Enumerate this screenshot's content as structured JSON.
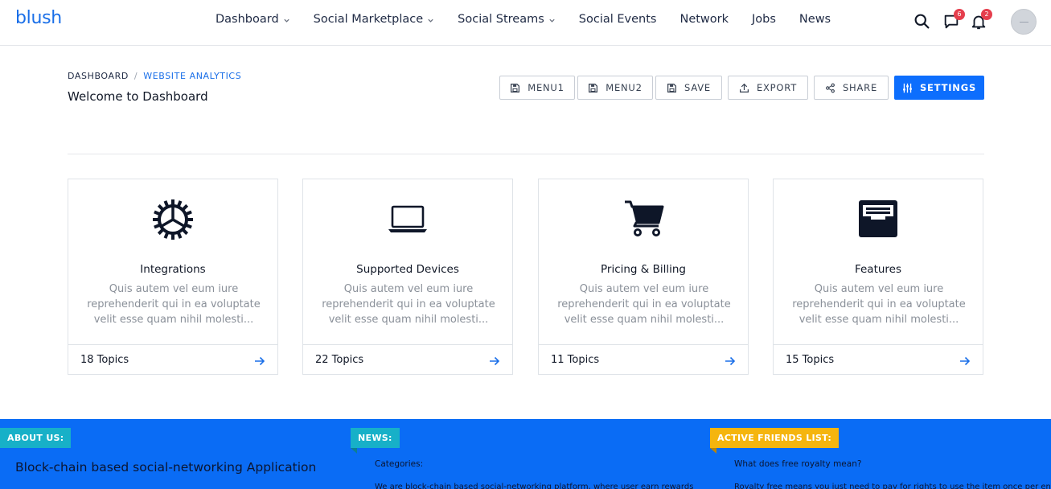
{
  "brand": "blush",
  "nav": [
    {
      "label": "Dashboard",
      "dropdown": true
    },
    {
      "label": "Social Marketplace",
      "dropdown": true
    },
    {
      "label": "Social Streams",
      "dropdown": true
    },
    {
      "label": "Social Events",
      "dropdown": false
    },
    {
      "label": "Network",
      "dropdown": false
    },
    {
      "label": "Jobs",
      "dropdown": false
    },
    {
      "label": "News",
      "dropdown": false
    }
  ],
  "header": {
    "messages_badge": "6",
    "notifications_badge": "2"
  },
  "breadcrumb": {
    "root": "DASHBOARD",
    "separator": "/",
    "current": "WEBSITE ANALYTICS"
  },
  "page_title": "Welcome to Dashboard",
  "toolbar": {
    "menu1": "MENU1",
    "menu2": "MENU2",
    "save": "SAVE",
    "export": "EXPORT",
    "share": "SHARE",
    "settings": "SETTINGS"
  },
  "cards": [
    {
      "icon": "gear-icon",
      "title": "Integrations",
      "desc": "Quis autem vel eum iure reprehenderit qui in ea voluptate velit esse quam nihil molesti...",
      "count": "18 Topics"
    },
    {
      "icon": "laptop-icon",
      "title": "Supported Devices",
      "desc": "Quis autem vel eum iure reprehenderit qui in ea voluptate velit esse quam nihil molesti...",
      "count": "22 Topics"
    },
    {
      "icon": "cart-icon",
      "title": "Pricing & Billing",
      "desc": "Quis autem vel eum iure reprehenderit qui in ea voluptate velit esse quam nihil molesti...",
      "count": "11 Topics"
    },
    {
      "icon": "inbox-icon",
      "title": "Features",
      "desc": "Quis autem vel eum iure reprehenderit qui in ea voluptate velit esse quam nihil molesti...",
      "count": "15 Topics"
    }
  ],
  "footer": {
    "about_tag": "ABOUT US:",
    "about_text": "Block-chain based social-networking Application",
    "news_tag": "NEWS:",
    "news_categories": "Categories:",
    "news_text": "We are block-chain based social-networking platform, where user earn rewards",
    "friends_tag": "ACTIVE FRIENDS LIST:",
    "friends_question": "What does free royalty mean?",
    "friends_text": "Royalty free means you just need to pay for rights to use the item once per end"
  },
  "colors": {
    "brand": "#1a6fe8",
    "primary_button": "#0d6efd",
    "footer_bg": "#0a6cf5",
    "tag_teal": "#17b0c8",
    "tag_amber": "#f5b50e",
    "badge": "#e53e4d"
  }
}
